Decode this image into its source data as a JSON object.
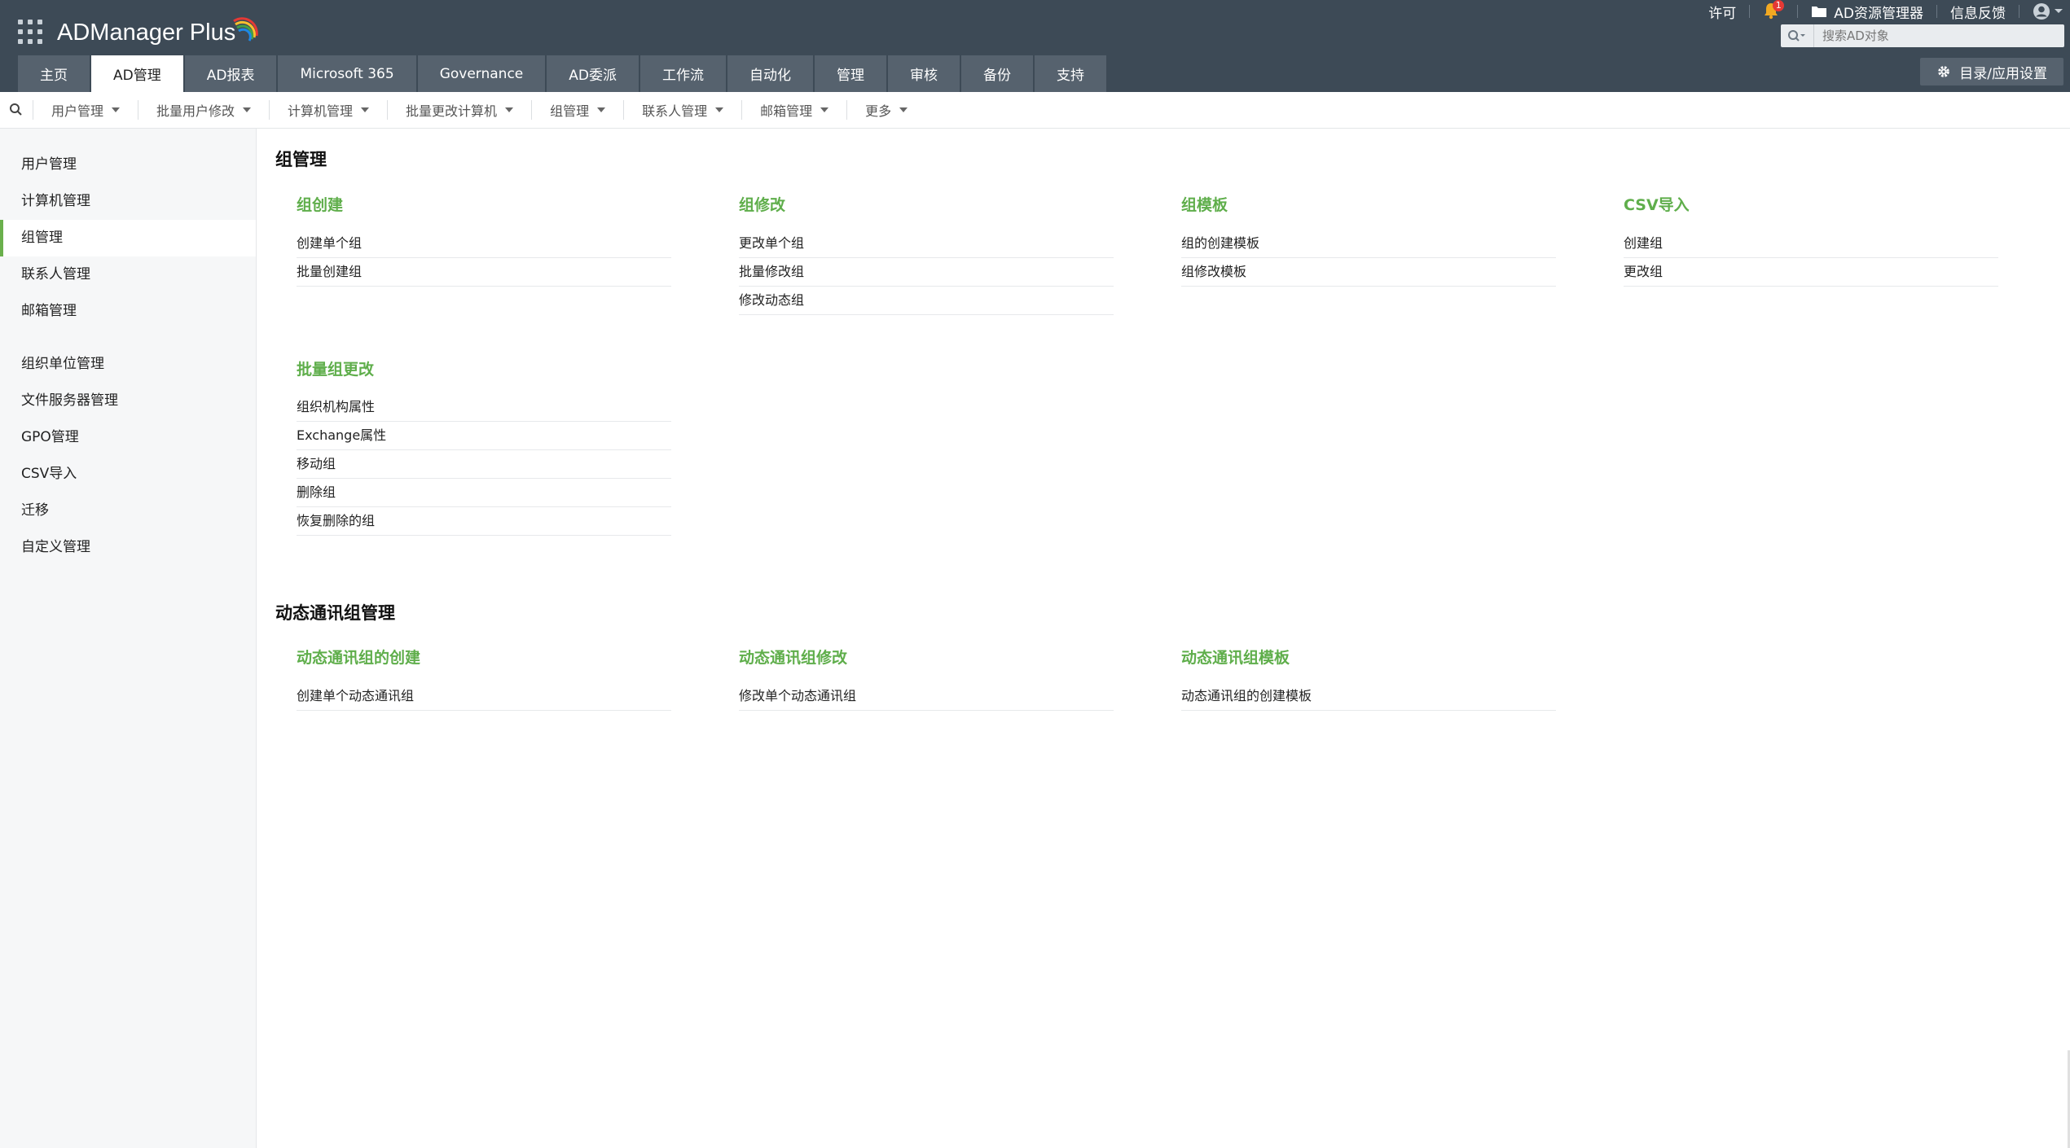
{
  "app": {
    "logo": "ADManager Plus",
    "brand_colors": [
      "#e53935",
      "#fbc02d",
      "#43a047",
      "#1e88e5"
    ]
  },
  "header": {
    "license": "许可",
    "notification_count": "1",
    "ad_explorer": "AD资源管理器",
    "feedback": "信息反馈",
    "search": {
      "placeholder": "搜索AD对象"
    },
    "settings_label": "目录/应用设置"
  },
  "tabs": [
    {
      "label": "主页"
    },
    {
      "label": "AD管理",
      "active": true
    },
    {
      "label": "AD报表"
    },
    {
      "label": "Microsoft 365"
    },
    {
      "label": "Governance"
    },
    {
      "label": "AD委派"
    },
    {
      "label": "工作流"
    },
    {
      "label": "自动化"
    },
    {
      "label": "管理"
    },
    {
      "label": "审核"
    },
    {
      "label": "备份"
    },
    {
      "label": "支持"
    }
  ],
  "subnav": [
    {
      "label": "用户管理"
    },
    {
      "label": "批量用户修改"
    },
    {
      "label": "计算机管理"
    },
    {
      "label": "批量更改计算机"
    },
    {
      "label": "组管理"
    },
    {
      "label": "联系人管理"
    },
    {
      "label": "邮箱管理"
    },
    {
      "label": "更多"
    }
  ],
  "sidebar": {
    "group1": [
      {
        "label": "用户管理"
      },
      {
        "label": "计算机管理"
      },
      {
        "label": "组管理",
        "active": true
      },
      {
        "label": "联系人管理"
      },
      {
        "label": "邮箱管理"
      }
    ],
    "group2": [
      {
        "label": "组织单位管理"
      },
      {
        "label": "文件服务器管理"
      },
      {
        "label": "GPO管理"
      },
      {
        "label": "CSV导入"
      },
      {
        "label": "迁移"
      },
      {
        "label": "自定义管理"
      }
    ]
  },
  "main": {
    "group_mgmt": {
      "title": "组管理",
      "columns": [
        {
          "title": "组创建",
          "links": [
            "创建单个组",
            "批量创建组"
          ]
        },
        {
          "title": "组修改",
          "links": [
            "更改单个组",
            "批量修改组",
            "修改动态组"
          ]
        },
        {
          "title": "组模板",
          "links": [
            "组的创建模板",
            "组修改模板"
          ]
        },
        {
          "title": "CSV导入",
          "links": [
            "创建组",
            "更改组"
          ]
        }
      ],
      "bulk": {
        "title": "批量组更改",
        "links": [
          "组织机构属性",
          "Exchange属性",
          "移动组",
          "删除组",
          "恢复删除的组"
        ]
      }
    },
    "dyn_mgmt": {
      "title": "动态通讯组管理",
      "columns": [
        {
          "title": "动态通讯组的创建",
          "links": [
            "创建单个动态通讯组"
          ]
        },
        {
          "title": "动态通讯组修改",
          "links": [
            "修改单个动态通讯组"
          ]
        },
        {
          "title": "动态通讯组模板",
          "links": [
            "动态通讯组的创建模板"
          ]
        }
      ]
    }
  }
}
